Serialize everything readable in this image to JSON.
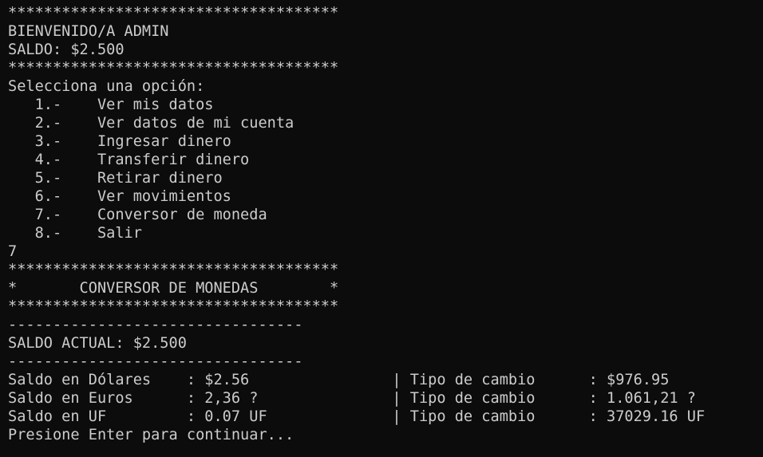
{
  "terminal": {
    "lines": [
      "*************************************",
      "BIENVENIDO/A ADMIN",
      "SALDO: $2.500",
      "*************************************",
      "Selecciona una opción:",
      "   1.-    Ver mis datos",
      "   2.-    Ver datos de mi cuenta",
      "   3.-    Ingresar dinero",
      "   4.-    Transferir dinero",
      "   5.-    Retirar dinero",
      "   6.-    Ver movimientos",
      "   7.-    Conversor de moneda",
      "   8.-    Salir",
      "7",
      "*************************************",
      "*       CONVERSOR DE MONEDAS        *",
      "*************************************",
      "---------------------------------",
      "SALDO ACTUAL: $2.500",
      "---------------------------------",
      "Saldo en Dólares    : $2.56                | Tipo de cambio      : $976.95",
      "Saldo en Euros      : 2,36 ?               | Tipo de cambio      : 1.061,21 ?",
      "Saldo en UF         : 0.07 UF              | Tipo de cambio      : 37029.16 UF",
      "Presione Enter para continuar..."
    ]
  }
}
